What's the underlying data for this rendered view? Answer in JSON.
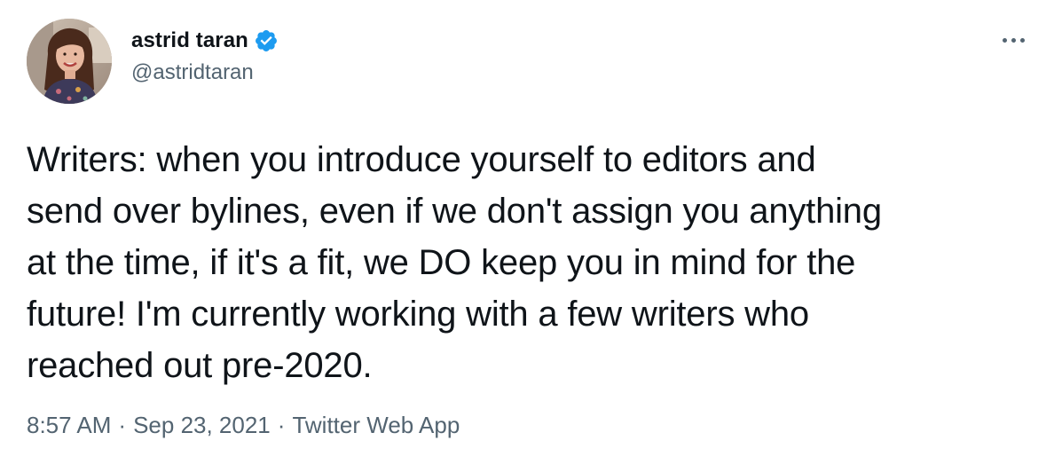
{
  "author": {
    "display_name": "astrid taran",
    "handle": "@astridtaran",
    "verified": true,
    "verified_color": "#1d9bf0"
  },
  "more_button": {
    "icon": "more-horizontal-icon"
  },
  "tweet": {
    "lines": [
      "Writers: when you introduce yourself to editors and",
      "send over bylines, even if we don't assign you anything",
      "at the time, if it's a fit, we DO keep you in mind for the",
      "future! I'm currently working with a few writers who",
      "reached out pre-2020."
    ]
  },
  "meta": {
    "time": "8:57 AM",
    "separator": "·",
    "date": "Sep 23, 2021",
    "source": "Twitter Web App"
  },
  "colors": {
    "text_primary": "#0f1419",
    "text_secondary": "#536471",
    "background": "#ffffff"
  }
}
